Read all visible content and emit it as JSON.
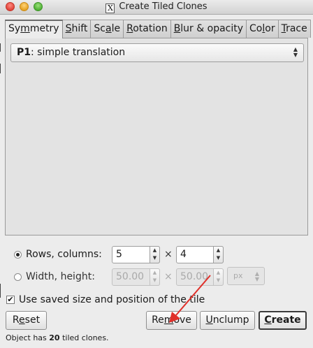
{
  "window": {
    "title": "Create Tiled Clones",
    "app_icon": "x11-icon",
    "app_icon_glyph": "X"
  },
  "tabs": [
    {
      "label": "Symmetry",
      "active": true
    },
    {
      "label": "Shift",
      "active": false
    },
    {
      "label": "Scale",
      "active": false
    },
    {
      "label": "Rotation",
      "active": false
    },
    {
      "label": "Blur & opacity",
      "active": false
    },
    {
      "label": "Color",
      "active": false
    },
    {
      "label": "Trace",
      "active": false
    }
  ],
  "symmetry": {
    "selected_bold": "P1",
    "selected_rest": ": simple translation"
  },
  "rows_columns": {
    "label": "Rows, columns:",
    "selected": true,
    "rows": "5",
    "columns": "4",
    "separator": "×"
  },
  "width_height": {
    "label": "Width, height:",
    "selected": false,
    "width": "50.00",
    "height": "50.00",
    "separator": "×",
    "unit": "px"
  },
  "use_saved": {
    "label": "Use saved size and position of the tile",
    "checked": true,
    "check_glyph": "✔"
  },
  "buttons": {
    "reset": "Reset",
    "remove": "Remove",
    "unclump": "Unclump",
    "create": "Create"
  },
  "status": {
    "prefix": "Object has ",
    "count": "20",
    "suffix": " tiled clones."
  },
  "annotation_color": "#e0302a"
}
